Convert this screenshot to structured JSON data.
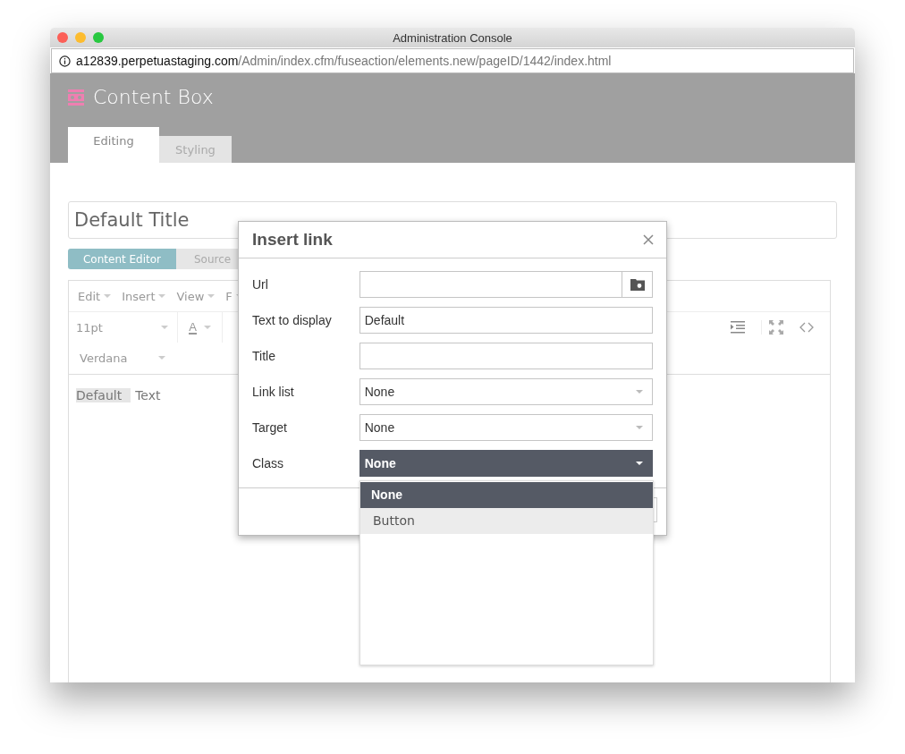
{
  "window": {
    "title": "Administration Console"
  },
  "address": {
    "host": "a12839.perpetuastaging.com",
    "path": "/Admin/index.cfm/fuseaction/elements.new/pageID/1442/index.html"
  },
  "app": {
    "title": "Content Box"
  },
  "tabs": [
    {
      "label": "Editing",
      "selected": true
    },
    {
      "label": "Styling",
      "selected": false
    }
  ],
  "title_field": {
    "value": "Default Title"
  },
  "editor_tabs": [
    {
      "label": "Content Editor",
      "selected": true
    },
    {
      "label": "Source",
      "selected": false
    }
  ],
  "menu": [
    "Edit",
    "Insert",
    "View",
    "F"
  ],
  "toolbar": {
    "font_size": "11pt",
    "font_color": "A",
    "font_family": "Verdana"
  },
  "content": [
    {
      "text": "Default",
      "selected": true
    },
    {
      "text": "Text",
      "selected": false
    }
  ],
  "dialog": {
    "title": "Insert link",
    "fields": [
      {
        "label": "Url",
        "kind": "browse"
      },
      {
        "label": "Text to display",
        "kind": "text",
        "value": "Default"
      },
      {
        "label": "Title",
        "kind": "text"
      },
      {
        "label": "Link list",
        "kind": "select",
        "value": "None",
        "open": false
      },
      {
        "label": "Target",
        "kind": "select",
        "value": "None",
        "open": false
      },
      {
        "label": "Class",
        "kind": "select",
        "value": "None",
        "open": true,
        "options": [
          {
            "label": "None",
            "selected": true,
            "highlighted": false
          },
          {
            "label": "Button",
            "selected": false,
            "highlighted": true
          }
        ]
      }
    ]
  }
}
